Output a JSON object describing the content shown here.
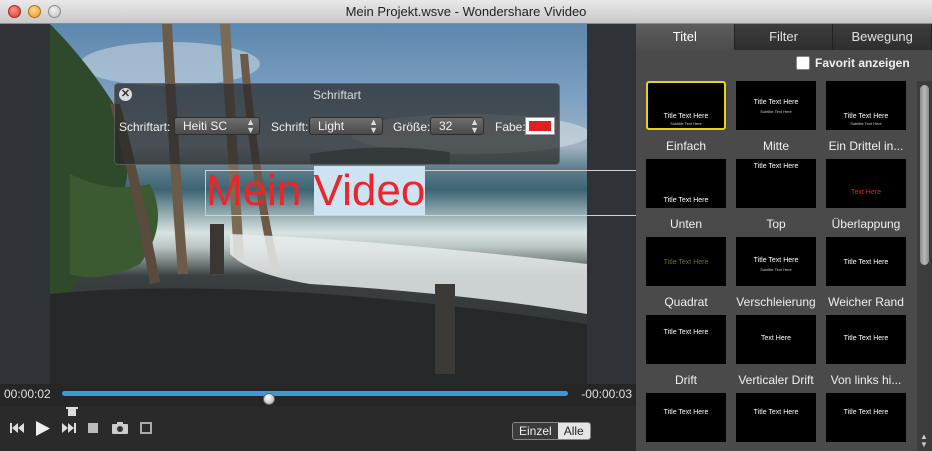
{
  "window": {
    "title": "Mein Projekt.wsve - Wondershare Vivideo"
  },
  "font_panel": {
    "title": "Schriftart",
    "font_label": "Schriftart:",
    "font_value": "Heiti SC",
    "style_label": "Schrift:",
    "style_value": "Light",
    "size_label": "Größe:",
    "size_value": "32",
    "color_label": "Fabe:",
    "color_value": "#e02020"
  },
  "overlay_text": {
    "part1": "Mein ",
    "part2": "Video"
  },
  "timeline": {
    "elapsed": "00:00:02",
    "remaining": "-00:00:03",
    "progress": 0.41
  },
  "controls": {
    "mode_single": "Einzel",
    "mode_all": "Alle",
    "active_mode": "Alle"
  },
  "right_panel": {
    "tabs": [
      {
        "label": "Titel",
        "active": true
      },
      {
        "label": "Filter",
        "active": false
      },
      {
        "label": "Bewegung",
        "active": false
      }
    ],
    "favorite_label": "Favorit anzeigen",
    "favorite_checked": false,
    "presets": [
      {
        "label": "Einfach",
        "thumb": "Title Text Here",
        "sub": "Subtitle Text Here",
        "selected": true
      },
      {
        "label": "Mitte",
        "thumb": "Title Text Here",
        "sub": "Subtitle Text Here",
        "selected": false
      },
      {
        "label": "Ein Drittel in...",
        "thumb": "Title Text Here",
        "sub": "Subtitle Text Here",
        "selected": false
      },
      {
        "label": "Unten",
        "thumb": "Title Text Here",
        "sub": "",
        "selected": false
      },
      {
        "label": "Top",
        "thumb": "Title Text Here",
        "sub": "",
        "selected": false
      },
      {
        "label": "Überlappung",
        "thumb": "Text Here",
        "sub": "",
        "selected": false
      },
      {
        "label": "Quadrat",
        "thumb": "Title Text Here",
        "sub": "",
        "selected": false
      },
      {
        "label": "Verschleierung",
        "thumb": "Title Text Here",
        "sub": "Subtitle Text Here",
        "selected": false
      },
      {
        "label": "Weicher Rand",
        "thumb": "Title Text Here",
        "sub": "",
        "selected": false
      },
      {
        "label": "Drift",
        "thumb": "Title Text Here",
        "sub": "",
        "selected": false
      },
      {
        "label": "Verticaler Drift",
        "thumb": "Text Here",
        "sub": "",
        "selected": false
      },
      {
        "label": "Von links hi...",
        "thumb": "Title Text Here",
        "sub": "",
        "selected": false
      },
      {
        "label": "",
        "thumb": "Title Text Here",
        "sub": "",
        "selected": false
      },
      {
        "label": "",
        "thumb": "Title Text Here",
        "sub": "",
        "selected": false
      },
      {
        "label": "",
        "thumb": "Title Text Here",
        "sub": "",
        "selected": false
      }
    ]
  }
}
